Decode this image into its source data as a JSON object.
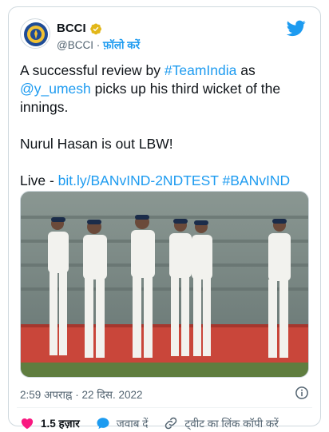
{
  "account": {
    "name": "BCCI",
    "handle": "@BCCI",
    "separator": "·",
    "follow_label": "फ़ॉलो करें",
    "verified": true
  },
  "tweet": {
    "text_line1_pre": "A successful review by ",
    "hashtag_teamindia": "#TeamIndia",
    "text_line1_post": " as",
    "mention": "@y_umesh",
    "text_line2_post": " picks up his third wicket of the innings.",
    "text_para2": "Nurul Hasan is out LBW!",
    "live_label": "Live - ",
    "link": "bit.ly/BANvIND-2NDTEST",
    "hashtag_banvind": "#BANvIND"
  },
  "meta": {
    "time": "2:59 अपराह्न",
    "date": "22 दिस. 2022"
  },
  "actions": {
    "like_count": "1.5 हज़ार",
    "reply_label": "जवाब दें",
    "copy_link_label": "ट्वीट का लिंक कॉपी करें"
  },
  "colors": {
    "twitter_blue": "#1d9bf0",
    "like_pink": "#f91880",
    "text_gray": "#536471"
  },
  "icons": {
    "bird": "twitter-bird-icon",
    "verified": "verified-badge-icon",
    "info": "info-icon",
    "like": "heart-icon",
    "reply": "reply-bubble-icon",
    "copy": "link-icon"
  }
}
